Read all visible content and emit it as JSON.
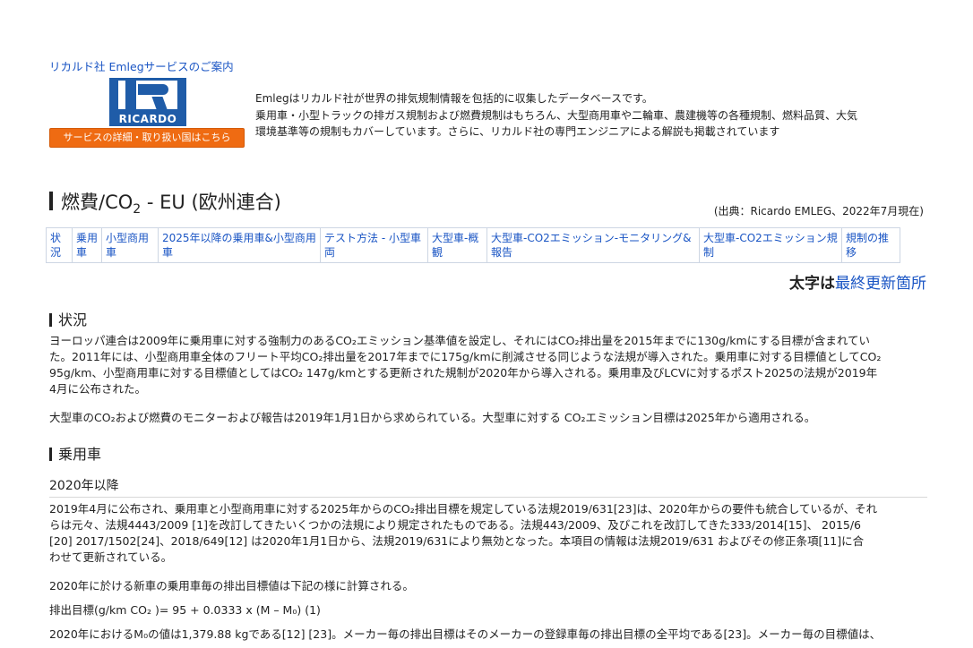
{
  "intro": {
    "title": "リカルド社 Emlegサービスのご案内",
    "logo_text": "RICARDO",
    "service_button": "サービスの詳細・取り扱い国はこちら",
    "line1": "Emlegはリカルド社が世界の排気規制情報を包括的に収集したデータベースです。",
    "line2": "乗用車・小型トラックの排ガス規制および燃費規制はもちろん、大型商用車や二輪車、農建機等の各種規制、燃料品質、大気",
    "line3": "環境基準等の規制もカバーしています。さらに、リカルド社の専門エンジニアによる解説も掲載されています"
  },
  "title": {
    "pre": "燃費/CO",
    "sub": "2",
    "post": " - EU (欧州連合)"
  },
  "source": "(出典：Ricardo EMLEG、2022年7月現在)",
  "nav": [
    "状況",
    "乗用車",
    "小型商用車",
    "2025年以降の乗用車&小型商用車",
    "テスト方法 - 小型車両",
    "大型車-概観",
    "大型車-CO2エミッション-モニタリング&報告",
    "大型車-CO2エミッション規制",
    "規制の推移"
  ],
  "legend_note": {
    "bold": "太字は",
    "link": "最終更新箇所"
  },
  "sections": {
    "status_heading": "状況",
    "status_p1_l1": "ヨーロッパ連合は2009年に乗用車に対する強制力のあるCO₂エミッション基準値を設定し、それにはCO₂排出量を2015年までに130g/kmにする目標が含まれてい",
    "status_p1_l2": "た。2011年には、小型商用車全体のフリート平均CO₂排出量を2017年までに175g/kmに削減させる同じような法規が導入された。乗用車に対する目標値としてCO₂",
    "status_p1_l3": "95g/km、小型商用車に対する目標値としてはCO₂ 147g/kmとする更新された規制が2020年から導入される。乗用車及びLCVに対するポスト2025の法規が2019年",
    "status_p1_l4": "4月に公布された。",
    "status_p2": "大型車のCO₂および燃費のモニターおよび報告は2019年1月1日から求められている。大型車に対する CO₂エミッション目標は2025年から適用される。",
    "passenger_heading": "乗用車",
    "since2020_heading": "2020年以降",
    "p3_l1": "2019年4月に公布され、乗用車と小型商用車に対する2025年からのCO₂排出目標を規定している法規2019/631[23]は、2020年からの要件も統合しているが、それ",
    "p3_l2": "らは元々、法規4443/2009 [1]を改訂してきたいくつかの法規により規定されたものである。法規443/2009、及びこれを改訂してきた333/2014[15]、 2015/6",
    "p3_l3": "[20] 2017/1502[24]、2018/649[12] は2020年1月1日から、法規2019/631により無効となった。本項目の情報は法規2019/631 およびその修正条項[11]に合",
    "p3_l4": "わせて更新されている。",
    "p4": "2020年に於ける新車の乗用車毎の排出目標値は下記の様に計算される。",
    "formula": "排出目標(g/km CO₂ )= 95 + 0.0333 x (M – M₀) (1)",
    "p5_l1": "2020年におけるM₀の値は1,379.88 kgである[12] [23]。メーカー毎の排出目標はそのメーカーの登録車毎の排出目標の全平均である[23]。メーカー毎の目標値は、"
  }
}
